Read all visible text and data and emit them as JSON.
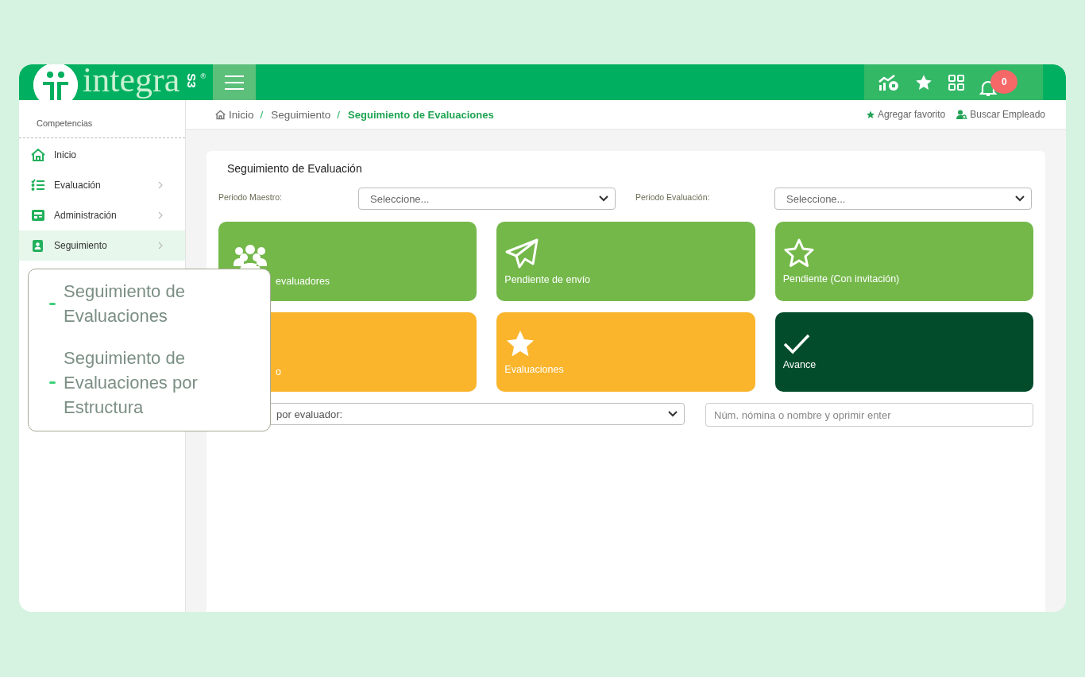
{
  "logo": {
    "word": "integra",
    "suffix": "S3",
    "mark": "®"
  },
  "header": {
    "notifications": "0"
  },
  "sidebar": {
    "section": "Competencias",
    "items": [
      {
        "label": "Inicio",
        "kind": "home",
        "has_children": false,
        "selected": false
      },
      {
        "label": "Evaluación",
        "kind": "checklist",
        "has_children": true,
        "selected": false
      },
      {
        "label": "Administración",
        "kind": "news",
        "has_children": true,
        "selected": false
      },
      {
        "label": "Seguimiento",
        "kind": "contact",
        "has_children": true,
        "selected": true
      }
    ]
  },
  "submenu": {
    "items": [
      "Seguimiento de Evaluaciones",
      "Seguimiento de Evaluaciones por Estructura"
    ]
  },
  "breadcrumb": {
    "items": [
      {
        "label": "Inicio",
        "current": false
      },
      {
        "label": "Seguimiento",
        "current": false
      },
      {
        "label": "Seguimiento de Evaluaciones",
        "current": true
      }
    ],
    "separator": "/"
  },
  "actions": [
    "Agregar favorito",
    "Buscar Empleado"
  ],
  "card": {
    "title": "Seguimiento de Evaluación",
    "filters": [
      {
        "label": "Periodo Maestro:",
        "value": "Seleccione..."
      },
      {
        "label": "Periodo Evaluación:",
        "value": "Seleccione..."
      }
    ],
    "tiles": [
      {
        "label": "evaluadores",
        "kind": "people",
        "color": "#74b84a"
      },
      {
        "label": "Pendiente de envío",
        "kind": "send",
        "color": "#74b84a"
      },
      {
        "label": "Pendiente (Con invitación)",
        "kind": "star-outline",
        "color": "#74b84a"
      },
      {
        "label": "o",
        "kind": "hidden",
        "color": "#fab52d"
      },
      {
        "label": "Evaluaciones",
        "kind": "star",
        "color": "#fab52d"
      },
      {
        "label": "Avance",
        "kind": "check",
        "color": "#024c2c"
      }
    ],
    "evaluator_filter": {
      "value": "por evaluador:"
    },
    "search": {
      "placeholder": "Núm. nómina o nombre y oprimir enter"
    }
  }
}
